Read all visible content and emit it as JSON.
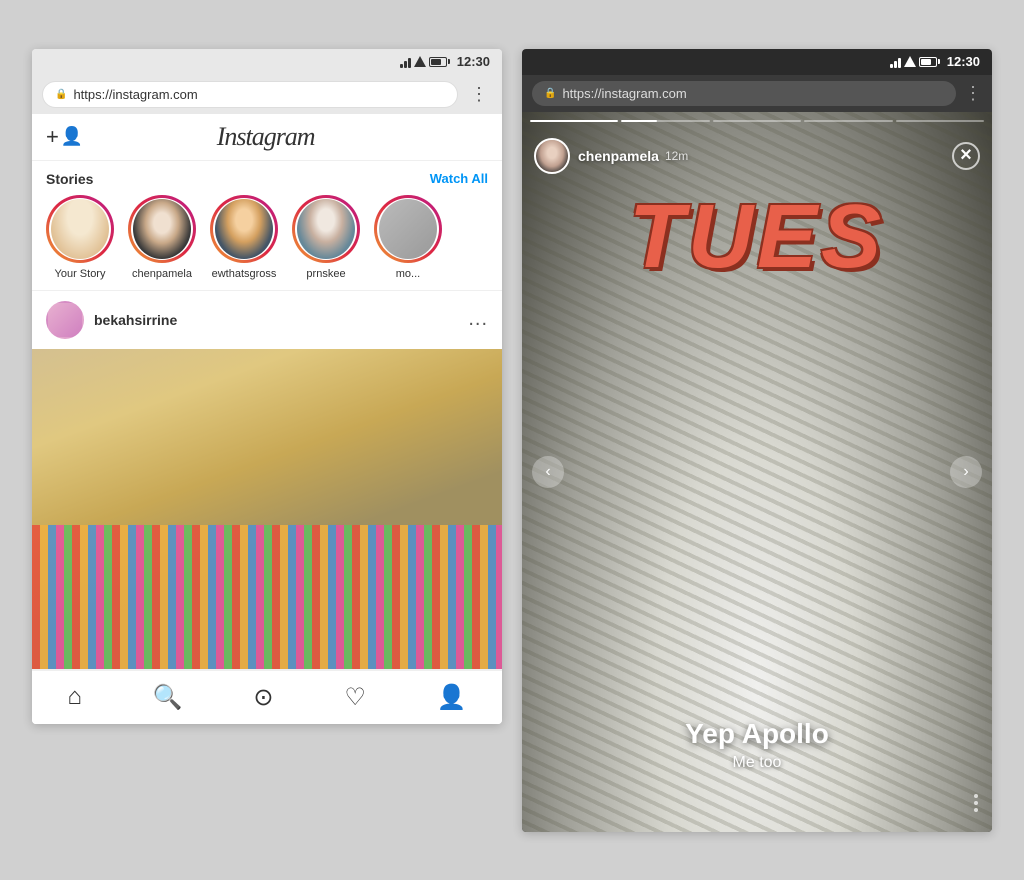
{
  "left_phone": {
    "status_bar": {
      "time": "12:30"
    },
    "browser": {
      "url": "https://instagram.com",
      "menu_dots": "⋮"
    },
    "header": {
      "logo": "Instagram",
      "add_friend_icon": "+"
    },
    "stories": {
      "label": "Stories",
      "watch_all": "Watch All",
      "items": [
        {
          "name": "Your Story",
          "avatar_class": "your-story-img"
        },
        {
          "name": "chenpamela",
          "avatar_class": "chen-img"
        },
        {
          "name": "ewthatsgross",
          "avatar_class": "ewt-img"
        },
        {
          "name": "prnskee",
          "avatar_class": "prnskee-img"
        },
        {
          "name": "mo...",
          "avatar_class": "avatar-more"
        }
      ]
    },
    "post": {
      "username": "bekahsirrine",
      "menu": "..."
    },
    "nav": {
      "home_icon": "⌂",
      "search_icon": "○",
      "camera_icon": "◎",
      "heart_icon": "♡",
      "profile_icon": "👤"
    }
  },
  "right_phone": {
    "status_bar": {
      "time": "12:30"
    },
    "browser": {
      "url": "https://instagram.com",
      "menu_dots": "⋮"
    },
    "story": {
      "username": "chenpamela",
      "time": "12m",
      "close_icon": "×",
      "tues_text": "TUES",
      "caption_main": "Yep Apollo",
      "caption_sub": "Me too",
      "progress_bars": [
        {
          "fill": 100
        },
        {
          "fill": 40
        },
        {
          "fill": 0
        },
        {
          "fill": 0
        },
        {
          "fill": 0
        }
      ],
      "nav_left": "‹",
      "nav_right": "›",
      "dots": 3
    }
  }
}
